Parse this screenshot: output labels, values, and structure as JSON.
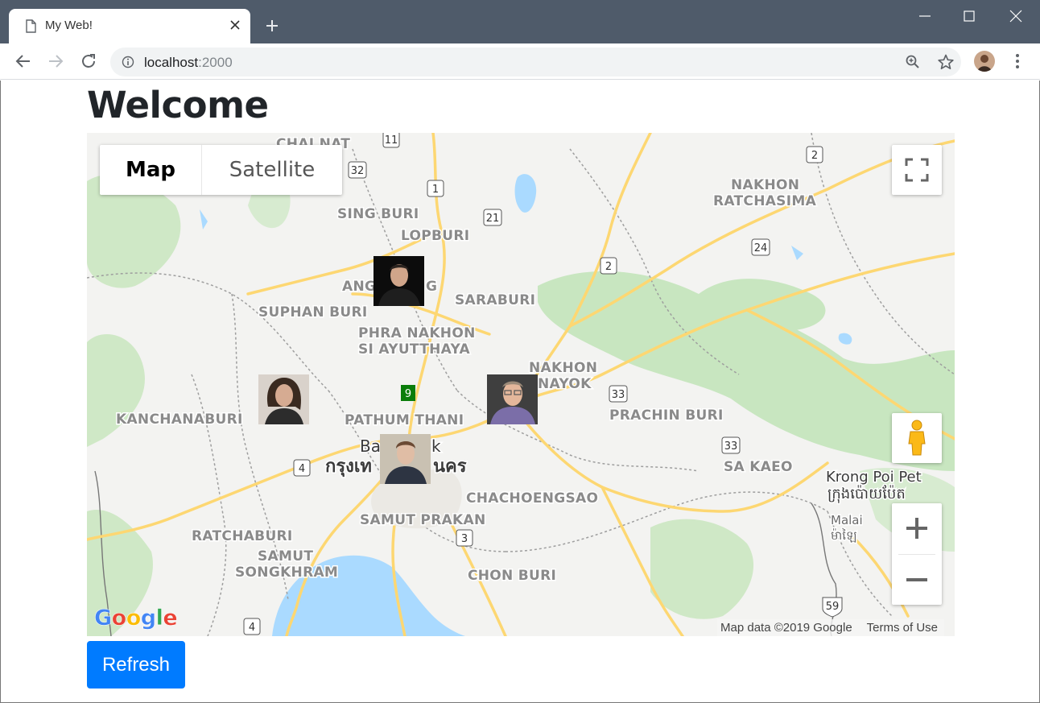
{
  "browser": {
    "tab_title": "My Web!",
    "url_host": "localhost",
    "url_port": ":2000"
  },
  "page": {
    "title": "Welcome",
    "refresh_label": "Refresh"
  },
  "map": {
    "type_control": {
      "map_label": "Map",
      "satellite_label": "Satellite",
      "selected": "Map"
    },
    "logo_text": "Google",
    "attribution": {
      "data_text": "Map data ©2019 Google",
      "terms_text": "Terms of Use"
    },
    "places": {
      "chainat": "CHAI NAT",
      "sing_buri": "SING BURI",
      "lopburi": "LOPBURI",
      "nakhon_ratchasima_1": "NAKHON",
      "nakhon_ratchasima_2": "RATCHASIMA",
      "ang_thong_a": "ANG",
      "ang_thong_b": "G",
      "saraburi": "SARABURI",
      "suphan_buri": "SUPHAN BURI",
      "ayutthaya_1": "PHRA NAKHON",
      "ayutthaya_2": "SI AYUTTHAYA",
      "nakhon_nayok_1": "NAKHON",
      "nakhon_nayok_2": "NAYOK",
      "kanchanaburi": "KANCHANABURI",
      "pathum_thani": "PATHUM THANI",
      "prachin_buri": "PRACHIN BURI",
      "bangkok_a": "Ba",
      "bangkok_b": "k",
      "bangkok_thai_a": "กรุงเท",
      "bangkok_thai_b": "นคร",
      "sa_kaeo": "SA KAEO",
      "krong_poi_pet": "Krong Poi Pet",
      "poi_pet_khmer": "ក្រុងប៉ោយប៉ែត",
      "chachoengsao": "CHACHOENGSAO",
      "samut_prakan": "SAMUT PRAKAN",
      "malai": "Malai",
      "malai_khmer": "ម៉ាឡៃ",
      "ratchaburi": "RATCHABURI",
      "samut_songkhram_1": "SAMUT",
      "samut_songkhram_2": "SONGKHRAM",
      "chon_buri": "CHON BURI"
    },
    "route_shields": [
      "11",
      "32",
      "1",
      "21",
      "2",
      "2",
      "24",
      "9",
      "33",
      "33",
      "4",
      "3",
      "4",
      "59"
    ],
    "markers": [
      {
        "name": "elon-musk-marker",
        "shirt": "#1e1e1e",
        "bg": "#0c0c0c",
        "skin": "#d0a58a",
        "hair": "#2b2420"
      },
      {
        "name": "sheryl-sandberg-marker",
        "shirt": "#2c2c2c",
        "bg": "#d9d2cb",
        "skin": "#d6ab92",
        "hair": "#3a2a20"
      },
      {
        "name": "bill-gates-marker",
        "shirt": "#7b6ea8",
        "bg": "#3f3f3f",
        "skin": "#e4b79b",
        "hair": "#9b8a78"
      },
      {
        "name": "mark-zuckerberg-marker",
        "shirt": "#2d3442",
        "bg": "#c9c1b2",
        "skin": "#e0bda5",
        "hair": "#6b4a34"
      }
    ],
    "colors": {
      "land": "#f3f3f1",
      "water": "#aadaff",
      "park": "#c8e6c0",
      "highway": "#fdd772",
      "road": "#ffffff",
      "border": "#9e9e9e"
    }
  },
  "colors": {
    "chrome": "#4f5b6a",
    "button_primary": "#007bff",
    "heading": "#212529"
  }
}
